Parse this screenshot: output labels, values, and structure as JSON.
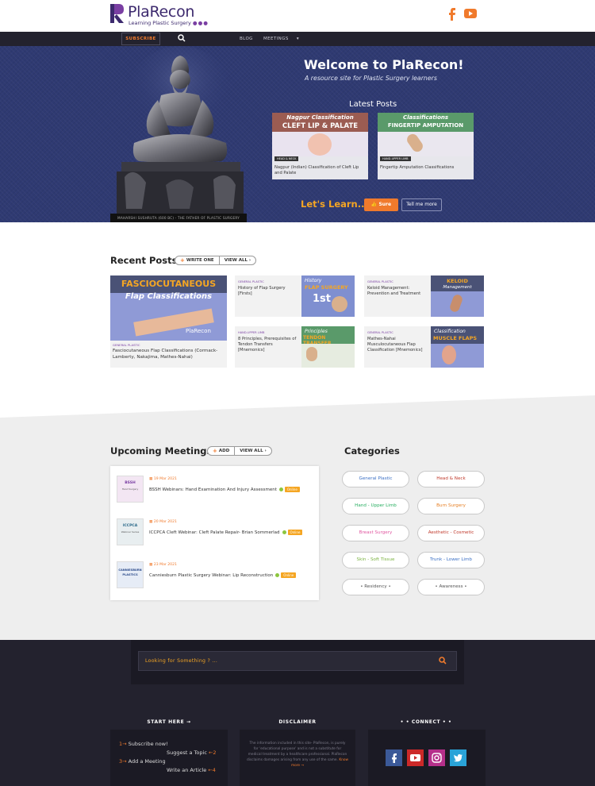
{
  "header": {
    "logo_letter": "R",
    "logo_name": "PlaRecon",
    "logo_tagline": "Learning Plastic Surgery",
    "logo_dots": "●●●",
    "social": [
      "facebook-icon",
      "youtube-icon"
    ]
  },
  "nav": {
    "subscribe": "SUBSCRIBE",
    "blog": "BLOG",
    "meetings": "MEETINGS"
  },
  "hero": {
    "title": "Welcome to PlaRecon!",
    "subtitle": "A resource site for Plastic Surgery learners",
    "statue_caption": "MAHARSHI SUSHRUTA (600 BC) - THE FATHER OF PLASTIC SURGERY",
    "latest_title": "Latest Posts",
    "latest_posts": [
      {
        "thumb_top": "Nagpur Classification",
        "thumb_main": "CLEFT LIP & PALATE",
        "badge": "HEAD & NECK",
        "title": "Nagpur (Indian) Classification of Cleft Lip and Palate"
      },
      {
        "thumb_top": "Classifications",
        "thumb_main": "FINGERTIP AMPUTATION",
        "badge": "HAND-UPPER LIMB",
        "title": "Fingertip Amputation Classifications"
      }
    ],
    "lets_learn": "Let's Learn...",
    "sure_label": "Sure",
    "tell_more_label": "Tell me more"
  },
  "recent": {
    "title": "Recent Posts",
    "write_one": "WRITE ONE",
    "view_all": "VIEW ALL",
    "featured": {
      "thumb_top": "FASCIOCUTANEOUS",
      "thumb_main": "Flap Classifications",
      "category": "GENERAL PLASTIC",
      "title": "Fasciocutaneous Flap Classifications (Cormack-Lamberty, Nakajima, Mathes-Nahai)"
    },
    "cards": [
      {
        "category": "GENERAL PLASTIC",
        "title": "History of Flap Surgery [Firsts]",
        "thumb_top": "History",
        "thumb_main": "FLAP SURGERY",
        "thumb_extra": "1st"
      },
      {
        "category": "GENERAL PLASTIC",
        "title": "Keloid Management: Prevention and Treatment",
        "thumb_top": "KELOID",
        "thumb_main": "Management",
        "thumb_extra": ""
      },
      {
        "category": "HAND-UPPER LIMB",
        "title": "8 Principles, Prerequisites of Tendon Transfers [Mnemonics]",
        "thumb_top": "Principles",
        "thumb_main": "TENDON TRANSFER",
        "thumb_extra": ""
      },
      {
        "category": "GENERAL PLASTIC",
        "title": "Mathes-Nahai Musculocutaneous Flap Classification [Mnemonics]",
        "thumb_top": "Classification",
        "thumb_main": "MUSCLE FLAPS",
        "thumb_extra": ""
      }
    ]
  },
  "meetings": {
    "title": "Upcoming Meetings",
    "add": "ADD",
    "view_all": "VIEW ALL",
    "items": [
      {
        "logo_top": "BSSH",
        "logo_bottom": "Hand Surgery",
        "date": "19 Mar 2021",
        "title": "BSSH Webinars: Hand Examination And Injury Assessment",
        "status": "Online"
      },
      {
        "logo_top": "ICCPCA",
        "logo_bottom": "Webinar Series",
        "date": "20 Mar 2021",
        "title": "ICCPCA Cleft Webinar: Cleft Palate Repair- Brian Sommerlad",
        "status": "Online"
      },
      {
        "logo_top": "CANNIESBURN",
        "logo_bottom": "PLASTICS",
        "date": "23 Mar 2021",
        "title": "Canniesburn Plastic Surgery Webinar: Lip Reconstruction",
        "status": "Online"
      }
    ]
  },
  "categories": {
    "title": "Categories",
    "items": [
      {
        "label": "General Plastic",
        "color": "#3a6fc4"
      },
      {
        "label": "Head & Neck",
        "color": "#c0392b"
      },
      {
        "label": "Hand - Upper Limb",
        "color": "#27ae60"
      },
      {
        "label": "Burn Surgery",
        "color": "#e67e22"
      },
      {
        "label": "Breast Surgery",
        "color": "#e056a0"
      },
      {
        "label": "Aesthetic - Cosmetic",
        "color": "#c0392b"
      },
      {
        "label": "Skin - Soft Tissue",
        "color": "#7cb342"
      },
      {
        "label": "Trunk - Lower Limb",
        "color": "#3a6fc4"
      },
      {
        "label": "• Residency •",
        "color": "#555555"
      },
      {
        "label": "• Awareness •",
        "color": "#555555"
      }
    ]
  },
  "footer": {
    "search_placeholder": "Looking for Something ? ...",
    "start_here_title": "START HERE →",
    "start_items": [
      {
        "num": "1→",
        "label": "Subscribe now!"
      },
      {
        "num": "←2",
        "label": "Suggest a Topic"
      },
      {
        "num": "3→",
        "label": "Add a Meeting"
      },
      {
        "num": "←4",
        "label": "Write an Article"
      }
    ],
    "disclaimer_title": "DISCLAIMER",
    "disclaimer_text": "The information included in this site- PlaRecon, is purely for 'educational purpose' and is not a substitute for medical treatment by a healthcare professional. PlaRecon disclaims damages arising from any use of the same.",
    "disclaimer_more": "Know more →",
    "connect_title": "• • CONNECT • •",
    "connect_icons": [
      "facebook-icon",
      "youtube-icon",
      "instagram-icon",
      "twitter-icon"
    ]
  },
  "colors": {
    "accent": "#f07a2c",
    "brand": "#3d2a6e",
    "nav_bg": "#23222e",
    "hero_bg": "#2f3a72"
  }
}
